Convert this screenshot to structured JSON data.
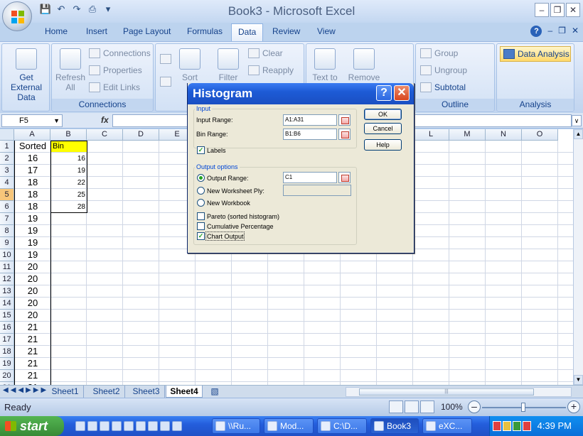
{
  "window": {
    "title": "Book3 - Microsoft Excel"
  },
  "ribbon_tabs": [
    "Home",
    "Insert",
    "Page Layout",
    "Formulas",
    "Data",
    "Review",
    "View"
  ],
  "active_tab": "Data",
  "ribbon": {
    "get_external_data": "Get External Data",
    "refresh_all": "Refresh All",
    "connections": "Connections",
    "properties": "Properties",
    "edit_links": "Edit Links",
    "connections_group": "Connections",
    "sort": "Sort",
    "filter": "Filter",
    "clear": "Clear",
    "reapply": "Reapply",
    "text_to": "Text to",
    "remove": "Remove",
    "group": "Group",
    "ungroup": "Ungroup",
    "subtotal": "Subtotal",
    "outline_group": "Outline",
    "data_analysis": "Data Analysis",
    "analysis_group": "Analysis"
  },
  "formula_bar": {
    "name_box": "F5",
    "fx": "fx",
    "value": ""
  },
  "columns": [
    "A",
    "B",
    "C",
    "D",
    "E",
    "F",
    "G",
    "H",
    "I",
    "J",
    "K",
    "L",
    "M",
    "N",
    "O"
  ],
  "rows": [
    "1",
    "2",
    "3",
    "4",
    "5",
    "6",
    "7",
    "8",
    "9",
    "10",
    "11",
    "12",
    "13",
    "14",
    "15",
    "16",
    "17",
    "18",
    "19",
    "20",
    "21"
  ],
  "selected_row": "5",
  "col_a": [
    "Sorted",
    "16",
    "17",
    "18",
    "18",
    "18",
    "19",
    "19",
    "19",
    "19",
    "20",
    "20",
    "20",
    "20",
    "20",
    "21",
    "21",
    "21",
    "21",
    "21",
    "21"
  ],
  "col_b": [
    "Bin",
    "16",
    "19",
    "22",
    "25",
    "28"
  ],
  "sheets": [
    "Sheet1",
    "Sheet2",
    "Sheet3",
    "Sheet4"
  ],
  "active_sheet": "Sheet4",
  "status": {
    "text": "Ready",
    "zoom": "100%"
  },
  "taskbar": {
    "start": "start",
    "tasks": [
      "\\\\Ru...",
      "Mod...",
      "C:\\D...",
      "Book3",
      "eXC..."
    ],
    "active_task": "Book3",
    "clock": "4:39 PM"
  },
  "dialog": {
    "title": "Histogram",
    "input_legend": "Input",
    "input_range_label": "Input Range:",
    "input_range_value": "A1:A31",
    "bin_range_label": "Bin Range:",
    "bin_range_value": "B1:B6",
    "labels_label": "Labels",
    "labels_checked": true,
    "output_legend": "Output options",
    "output_range_label": "Output Range:",
    "output_range_value": "C1",
    "new_ply_label": "New Worksheet Ply:",
    "new_workbook_label": "New Workbook",
    "pareto_label": "Pareto (sorted histogram)",
    "cumulative_label": "Cumulative Percentage",
    "chart_output_label": "Chart Output",
    "chart_output_checked": true,
    "ok": "OK",
    "cancel": "Cancel",
    "help": "Help"
  }
}
